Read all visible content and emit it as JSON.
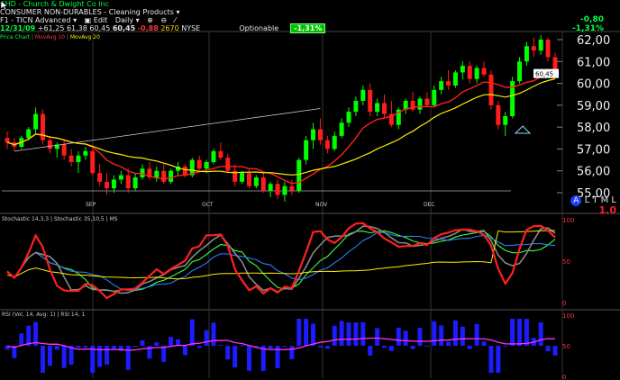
{
  "header": {
    "symbol": "CHD",
    "company": "Church & Dwight Co Inc",
    "sector": "CONSUMER NON-DURABLES - Cleaning Products",
    "layout_name": "F1 - TICN Advanced",
    "edit_label": "Edit",
    "period": "Daily"
  },
  "quote": {
    "date": "12/31/09",
    "open_chg": "+61,25",
    "low": "61,38",
    "high": "60,45",
    "last": "60,45",
    "change": "-0,88",
    "volume": "2670",
    "exchange": "NYSE",
    "optionable_label": "Optionable",
    "pct_badge": "-1,31%"
  },
  "top_right": {
    "change": "-0,80",
    "pct": "-1,31%"
  },
  "legend": {
    "price_chart": "Price Chart",
    "ma1": "MovAvg 10",
    "ma2": "MovAvg 20",
    "sep": "|"
  },
  "y_axis": {
    "labels": [
      "62,00",
      "61,00",
      "60,00",
      "59,00",
      "58,00",
      "57,00",
      "56,00",
      "55,00"
    ],
    "last_tag": "60,45"
  },
  "x_axis": {
    "months": [
      "SEP",
      "OCT",
      "NOV",
      "DEC"
    ]
  },
  "indicators": {
    "stoch_legend": "Stochastic 14,3,3 | Stochastic 35,10,5 | MS",
    "stoch_scale": [
      "100",
      "50",
      "0"
    ],
    "rsi_legend": "RSI (Vol, 14, Avg: 1) | RSI 14, 1",
    "rsi_scale": [
      "100",
      "50",
      "0"
    ]
  },
  "footer": {
    "al": "A",
    "tml": "L T M L",
    "version": "1.0"
  },
  "colors": {
    "up": "#00ff00",
    "down": "#ff1c1c",
    "ma10": "#ff2020",
    "ma20": "#ffee00",
    "trendline": "#d0d0d0",
    "grid": "#333333"
  },
  "chart_data": {
    "type": "candlestick",
    "ylim": [
      55,
      62.5
    ],
    "ohlc": [
      [
        57.5,
        57.8,
        57.0,
        57.3
      ],
      [
        57.3,
        57.5,
        56.9,
        57.1
      ],
      [
        57.1,
        57.6,
        57.0,
        57.5
      ],
      [
        57.5,
        58.0,
        57.4,
        57.9
      ],
      [
        57.9,
        58.9,
        57.7,
        58.6
      ],
      [
        58.6,
        58.8,
        57.2,
        57.4
      ],
      [
        57.4,
        57.6,
        56.8,
        57.0
      ],
      [
        57.0,
        57.3,
        56.6,
        57.2
      ],
      [
        57.2,
        57.4,
        56.5,
        56.7
      ],
      [
        56.7,
        57.0,
        56.2,
        56.4
      ],
      [
        56.4,
        56.9,
        55.9,
        56.7
      ],
      [
        56.7,
        57.1,
        56.5,
        56.9
      ],
      [
        56.9,
        57.0,
        55.8,
        55.9
      ],
      [
        55.9,
        56.3,
        55.3,
        55.5
      ],
      [
        55.5,
        55.9,
        54.9,
        55.2
      ],
      [
        55.2,
        55.8,
        55.0,
        55.6
      ],
      [
        55.6,
        56.0,
        55.4,
        55.8
      ],
      [
        55.8,
        56.1,
        55.0,
        55.2
      ],
      [
        55.2,
        55.9,
        55.1,
        55.7
      ],
      [
        55.7,
        56.3,
        55.6,
        56.1
      ],
      [
        56.1,
        56.4,
        55.6,
        55.7
      ],
      [
        55.7,
        56.2,
        55.5,
        56.0
      ],
      [
        56.0,
        56.3,
        55.4,
        55.5
      ],
      [
        55.5,
        56.1,
        55.4,
        56.0
      ],
      [
        56.0,
        56.4,
        55.8,
        56.2
      ],
      [
        56.2,
        56.3,
        55.7,
        55.8
      ],
      [
        55.8,
        56.6,
        55.7,
        56.5
      ],
      [
        56.5,
        56.7,
        56.0,
        56.1
      ],
      [
        56.1,
        56.5,
        55.9,
        56.4
      ],
      [
        56.4,
        57.0,
        56.3,
        56.9
      ],
      [
        56.9,
        57.3,
        56.5,
        56.6
      ],
      [
        56.6,
        56.8,
        55.9,
        56.0
      ],
      [
        56.0,
        56.3,
        55.3,
        55.5
      ],
      [
        55.5,
        56.0,
        55.4,
        55.9
      ],
      [
        55.9,
        56.1,
        55.2,
        55.3
      ],
      [
        55.3,
        55.8,
        55.2,
        55.7
      ],
      [
        55.7,
        55.9,
        55.0,
        55.1
      ],
      [
        55.1,
        55.5,
        54.8,
        55.4
      ],
      [
        55.4,
        55.6,
        54.7,
        54.9
      ],
      [
        54.9,
        55.5,
        54.6,
        55.3
      ],
      [
        55.3,
        55.6,
        54.9,
        55.1
      ],
      [
        55.1,
        56.6,
        55.0,
        56.5
      ],
      [
        56.5,
        57.6,
        56.3,
        57.4
      ],
      [
        57.4,
        58.2,
        57.0,
        57.9
      ],
      [
        57.9,
        58.4,
        57.2,
        57.4
      ],
      [
        57.4,
        57.6,
        56.8,
        57.0
      ],
      [
        57.0,
        57.8,
        56.9,
        57.6
      ],
      [
        57.6,
        58.4,
        57.5,
        58.2
      ],
      [
        58.2,
        58.9,
        58.0,
        58.7
      ],
      [
        58.7,
        59.4,
        58.5,
        59.2
      ],
      [
        59.2,
        59.9,
        59.0,
        59.7
      ],
      [
        59.7,
        60.0,
        58.5,
        58.7
      ],
      [
        58.7,
        59.3,
        58.5,
        59.1
      ],
      [
        59.1,
        59.5,
        58.4,
        58.6
      ],
      [
        58.6,
        59.2,
        58.0,
        58.1
      ],
      [
        58.1,
        58.9,
        57.9,
        58.8
      ],
      [
        58.8,
        59.3,
        58.6,
        59.2
      ],
      [
        59.2,
        59.6,
        58.7,
        58.8
      ],
      [
        58.8,
        59.4,
        58.6,
        59.3
      ],
      [
        59.3,
        59.6,
        58.9,
        59.0
      ],
      [
        59.0,
        59.9,
        58.9,
        59.7
      ],
      [
        59.7,
        60.3,
        59.5,
        60.1
      ],
      [
        60.1,
        60.6,
        59.7,
        59.9
      ],
      [
        59.9,
        60.6,
        59.8,
        60.5
      ],
      [
        60.5,
        61.0,
        60.2,
        60.8
      ],
      [
        60.8,
        61.0,
        60.0,
        60.2
      ],
      [
        60.2,
        60.8,
        60.0,
        60.7
      ],
      [
        60.7,
        61.0,
        60.3,
        60.4
      ],
      [
        60.4,
        60.6,
        58.8,
        59.0
      ],
      [
        59.0,
        59.2,
        57.9,
        58.1
      ],
      [
        58.1,
        58.7,
        57.6,
        58.5
      ],
      [
        58.5,
        60.3,
        58.4,
        60.1
      ],
      [
        60.1,
        61.2,
        60.0,
        61.0
      ],
      [
        61.0,
        61.9,
        60.8,
        61.7
      ],
      [
        61.7,
        62.1,
        61.2,
        61.5
      ],
      [
        61.5,
        62.2,
        61.3,
        62.0
      ],
      [
        62.0,
        62.1,
        61.0,
        61.2
      ],
      [
        61.2,
        61.4,
        60.3,
        60.45
      ]
    ]
  }
}
